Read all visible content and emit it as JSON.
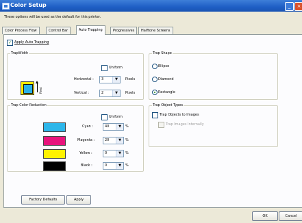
{
  "window": {
    "title": "Color Setup"
  },
  "info_text": "These options will be used as the default for this printer.",
  "tabs": [
    {
      "label": "Color Process Flow"
    },
    {
      "label": "Control Bar"
    },
    {
      "label": "Auto Trapping"
    },
    {
      "label": "Progressives"
    },
    {
      "label": "Halftone Screens"
    }
  ],
  "apply_auto_trapping": {
    "label": "Apply Auto Trapping",
    "checked": true
  },
  "trap_width": {
    "legend": "TrapWidth",
    "uniform_label": "Uniform",
    "horizontal_label": "Horizontal :",
    "horizontal_value": "3",
    "vertical_label": "Vertical :",
    "vertical_value": "2",
    "units": "Pixels",
    "feed_label": "Feed"
  },
  "trap_shape": {
    "legend": "Trap Shape",
    "options": [
      {
        "label": "Ellipse",
        "selected": false
      },
      {
        "label": "Diamond",
        "selected": false
      },
      {
        "label": "Rectangle",
        "selected": true
      }
    ]
  },
  "trap_color_reduction": {
    "legend": "Trap Color Reduction",
    "uniform_label": "Uniform",
    "unit": "%",
    "rows": [
      {
        "label": "Cyan :",
        "value": "40",
        "color": "#2db6ea"
      },
      {
        "label": "Magenta :",
        "value": "20",
        "color": "#e8147c"
      },
      {
        "label": "Yellow :",
        "value": "0",
        "color": "#fff200"
      },
      {
        "label": "Black :",
        "value": "0",
        "color": "#000000"
      }
    ]
  },
  "trap_object_types": {
    "legend": "Trap Object Types",
    "trap_objects_label": "Trap Objects to Images",
    "trap_images_label": "Trap Images Internally"
  },
  "buttons": {
    "factory_defaults": "Factory Defaults",
    "apply": "Apply",
    "ok": "OK",
    "cancel": "Cancel"
  }
}
